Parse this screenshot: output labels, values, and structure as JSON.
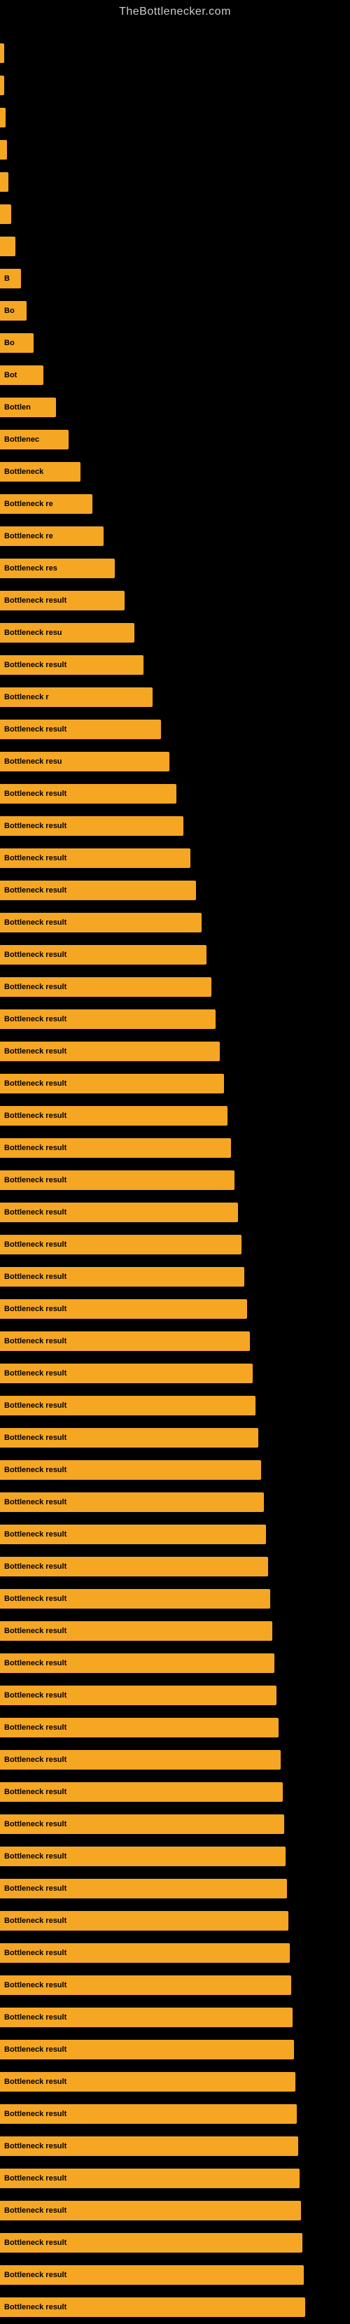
{
  "site": {
    "title": "TheBottlenecker.com"
  },
  "chart": {
    "label": "Bottleneck result",
    "bars": [
      {
        "id": 1,
        "width_class": "bar-1",
        "label": ""
      },
      {
        "id": 2,
        "width_class": "bar-2",
        "label": ""
      },
      {
        "id": 3,
        "width_class": "bar-3",
        "label": ""
      },
      {
        "id": 4,
        "width_class": "bar-4",
        "label": ""
      },
      {
        "id": 5,
        "width_class": "bar-5",
        "label": ""
      },
      {
        "id": 6,
        "width_class": "bar-6",
        "label": ""
      },
      {
        "id": 7,
        "width_class": "bar-7",
        "label": ""
      },
      {
        "id": 8,
        "width_class": "bar-8",
        "label": "B"
      },
      {
        "id": 9,
        "width_class": "bar-9",
        "label": "Bo"
      },
      {
        "id": 10,
        "width_class": "bar-10",
        "label": "Bo"
      },
      {
        "id": 11,
        "width_class": "bar-11",
        "label": "Bot"
      },
      {
        "id": 12,
        "width_class": "bar-12",
        "label": "Bottlen"
      },
      {
        "id": 13,
        "width_class": "bar-13",
        "label": "Bottlenec"
      },
      {
        "id": 14,
        "width_class": "bar-14",
        "label": "Bottleneck"
      },
      {
        "id": 15,
        "width_class": "bar-15",
        "label": "Bottleneck re"
      },
      {
        "id": 16,
        "width_class": "bar-16",
        "label": "Bottleneck re"
      },
      {
        "id": 17,
        "width_class": "bar-17",
        "label": "Bottleneck res"
      },
      {
        "id": 18,
        "width_class": "bar-18",
        "label": "Bottleneck result"
      },
      {
        "id": 19,
        "width_class": "bar-19",
        "label": "Bottleneck resu"
      },
      {
        "id": 20,
        "width_class": "bar-20",
        "label": "Bottleneck result"
      },
      {
        "id": 21,
        "width_class": "bar-21",
        "label": "Bottleneck r"
      },
      {
        "id": 22,
        "width_class": "bar-22",
        "label": "Bottleneck result"
      },
      {
        "id": 23,
        "width_class": "bar-23",
        "label": "Bottleneck resu"
      },
      {
        "id": 24,
        "width_class": "bar-24",
        "label": "Bottleneck result"
      },
      {
        "id": 25,
        "width_class": "bar-25",
        "label": "Bottleneck result"
      },
      {
        "id": 26,
        "width_class": "bar-26",
        "label": "Bottleneck result"
      },
      {
        "id": 27,
        "width_class": "bar-27",
        "label": "Bottleneck result"
      },
      {
        "id": 28,
        "width_class": "bar-28",
        "label": "Bottleneck result"
      },
      {
        "id": 29,
        "width_class": "bar-29",
        "label": "Bottleneck result"
      },
      {
        "id": 30,
        "width_class": "bar-30",
        "label": "Bottleneck result"
      },
      {
        "id": 31,
        "width_class": "bar-31",
        "label": "Bottleneck result"
      },
      {
        "id": 32,
        "width_class": "bar-32",
        "label": "Bottleneck result"
      },
      {
        "id": 33,
        "width_class": "bar-33",
        "label": "Bottleneck result"
      },
      {
        "id": 34,
        "width_class": "bar-34",
        "label": "Bottleneck result"
      },
      {
        "id": 35,
        "width_class": "bar-35",
        "label": "Bottleneck result"
      },
      {
        "id": 36,
        "width_class": "bar-36",
        "label": "Bottleneck result"
      },
      {
        "id": 37,
        "width_class": "bar-37",
        "label": "Bottleneck result"
      },
      {
        "id": 38,
        "width_class": "bar-38",
        "label": "Bottleneck result"
      },
      {
        "id": 39,
        "width_class": "bar-39",
        "label": "Bottleneck result"
      },
      {
        "id": 40,
        "width_class": "bar-40",
        "label": "Bottleneck result"
      },
      {
        "id": 41,
        "width_class": "bar-41",
        "label": "Bottleneck result"
      },
      {
        "id": 42,
        "width_class": "bar-42",
        "label": "Bottleneck result"
      },
      {
        "id": 43,
        "width_class": "bar-43",
        "label": "Bottleneck result"
      },
      {
        "id": 44,
        "width_class": "bar-44",
        "label": "Bottleneck result"
      },
      {
        "id": 45,
        "width_class": "bar-45",
        "label": "Bottleneck result"
      },
      {
        "id": 46,
        "width_class": "bar-46",
        "label": "Bottleneck result"
      },
      {
        "id": 47,
        "width_class": "bar-47",
        "label": "Bottleneck result"
      },
      {
        "id": 48,
        "width_class": "bar-48",
        "label": "Bottleneck result"
      },
      {
        "id": 49,
        "width_class": "bar-49",
        "label": "Bottleneck result"
      },
      {
        "id": 50,
        "width_class": "bar-50",
        "label": "Bottleneck result"
      },
      {
        "id": 51,
        "width_class": "bar-51",
        "label": "Bottleneck result"
      },
      {
        "id": 52,
        "width_class": "bar-52",
        "label": "Bottleneck result"
      },
      {
        "id": 53,
        "width_class": "bar-53",
        "label": "Bottleneck result"
      },
      {
        "id": 54,
        "width_class": "bar-54",
        "label": "Bottleneck result"
      },
      {
        "id": 55,
        "width_class": "bar-55",
        "label": "Bottleneck result"
      },
      {
        "id": 56,
        "width_class": "bar-56",
        "label": "Bottleneck result"
      },
      {
        "id": 57,
        "width_class": "bar-57",
        "label": "Bottleneck result"
      },
      {
        "id": 58,
        "width_class": "bar-58",
        "label": "Bottleneck result"
      },
      {
        "id": 59,
        "width_class": "bar-59",
        "label": "Bottleneck result"
      },
      {
        "id": 60,
        "width_class": "bar-60",
        "label": "Bottleneck result"
      },
      {
        "id": 61,
        "width_class": "bar-61",
        "label": "Bottleneck result"
      },
      {
        "id": 62,
        "width_class": "bar-62",
        "label": "Bottleneck result"
      },
      {
        "id": 63,
        "width_class": "bar-63",
        "label": "Bottleneck result"
      },
      {
        "id": 64,
        "width_class": "bar-64",
        "label": "Bottleneck result"
      },
      {
        "id": 65,
        "width_class": "bar-65",
        "label": "Bottleneck result"
      },
      {
        "id": 66,
        "width_class": "bar-66",
        "label": "Bottleneck result"
      },
      {
        "id": 67,
        "width_class": "bar-67",
        "label": "Bottleneck result"
      },
      {
        "id": 68,
        "width_class": "bar-68",
        "label": "Bottleneck result"
      },
      {
        "id": 69,
        "width_class": "bar-69",
        "label": "Bottleneck result"
      },
      {
        "id": 70,
        "width_class": "bar-70",
        "label": "Bottleneck result"
      },
      {
        "id": 71,
        "width_class": "bar-71",
        "label": "Bottleneck result"
      }
    ]
  }
}
